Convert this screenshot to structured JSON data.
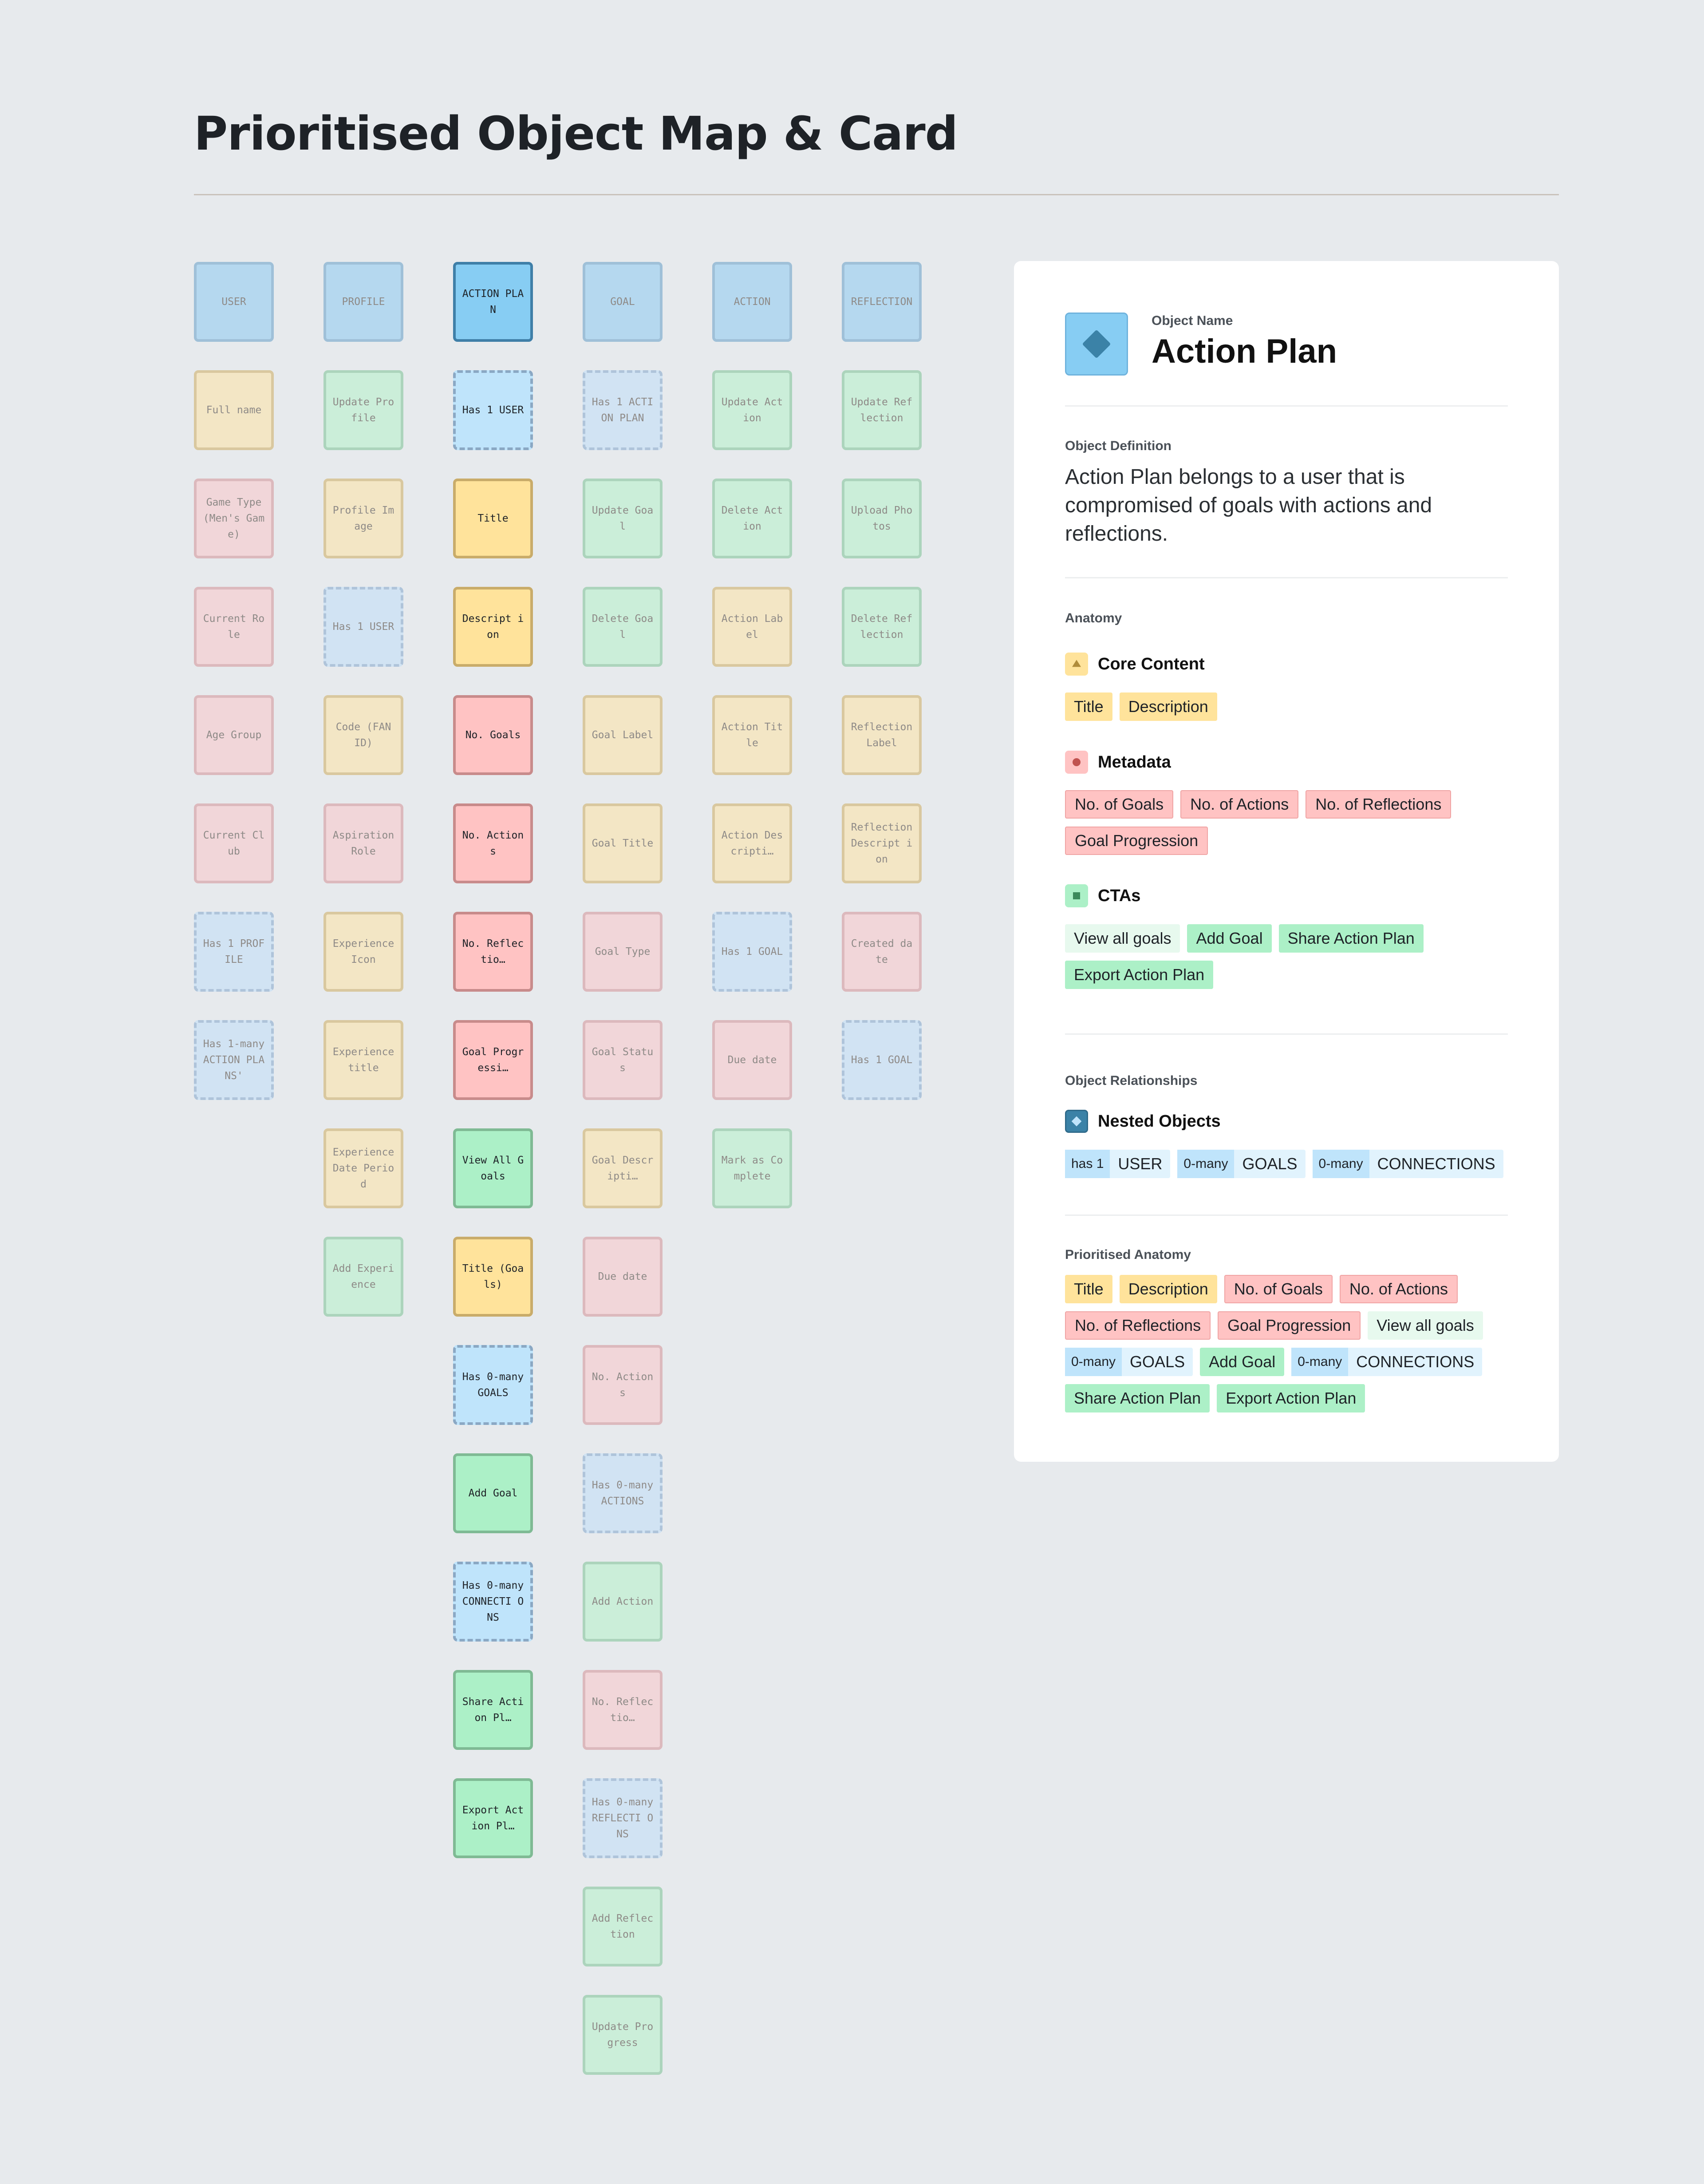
{
  "title": "Prioritised Object Map & Card",
  "map": {
    "columns": [
      {
        "header": "USER",
        "cells": [
          {
            "label": "Full name",
            "type": "core"
          },
          {
            "label": "Game Type (Men's Game)",
            "type": "meta"
          },
          {
            "label": "Current Role",
            "type": "meta"
          },
          {
            "label": "Age Group",
            "type": "meta"
          },
          {
            "label": "Current Club",
            "type": "meta"
          },
          {
            "label": "Has 1 PROFILE",
            "type": "nest"
          },
          {
            "label": "Has 1-many ACTION PLANS'",
            "type": "nest"
          }
        ]
      },
      {
        "header": "PROFILE",
        "cells": [
          {
            "label": "Update Profile",
            "type": "cta"
          },
          {
            "label": "Profile Image",
            "type": "core"
          },
          {
            "label": "Has 1 USER",
            "type": "nest"
          },
          {
            "label": "Code (FAN ID)",
            "type": "core"
          },
          {
            "label": "Aspiration Role",
            "type": "meta"
          },
          {
            "label": "Experience Icon",
            "type": "core"
          },
          {
            "label": "Experience title",
            "type": "core"
          },
          {
            "label": "Experience Date Period",
            "type": "core"
          },
          {
            "label": "Add Experience",
            "type": "cta"
          }
        ]
      },
      {
        "header": "ACTION PLAN",
        "active": true,
        "cells": [
          {
            "label": "Has 1 USER",
            "type": "nest"
          },
          {
            "label": "Title",
            "type": "core"
          },
          {
            "label": "Descript ion",
            "type": "core"
          },
          {
            "label": "No. Goals",
            "type": "meta"
          },
          {
            "label": "No. Actions",
            "type": "meta"
          },
          {
            "label": "No. Reflectio…",
            "type": "meta"
          },
          {
            "label": "Goal Progressi…",
            "type": "meta"
          },
          {
            "label": "View All Goals",
            "type": "cta"
          },
          {
            "label": "Title (Goals)",
            "type": "core"
          },
          {
            "label": "Has 0-many GOALS",
            "type": "nest"
          },
          {
            "label": "Add Goal",
            "type": "cta"
          },
          {
            "label": "Has 0-many CONNECTI ONS",
            "type": "nest"
          },
          {
            "label": "Share Action Pl…",
            "type": "cta"
          },
          {
            "label": "Export Action Pl…",
            "type": "cta"
          }
        ]
      },
      {
        "header": "GOAL",
        "cells": [
          {
            "label": "Has 1 ACTION PLAN",
            "type": "nest"
          },
          {
            "label": "Update Goal",
            "type": "cta"
          },
          {
            "label": "Delete Goal",
            "type": "cta"
          },
          {
            "label": "Goal Label",
            "type": "core"
          },
          {
            "label": "Goal Title",
            "type": "core"
          },
          {
            "label": "Goal Type",
            "type": "meta"
          },
          {
            "label": "Goal Status",
            "type": "meta"
          },
          {
            "label": "Goal Descripti…",
            "type": "core"
          },
          {
            "label": "Due date",
            "type": "meta"
          },
          {
            "label": "No. Actions",
            "type": "meta"
          },
          {
            "label": "Has 0-many ACTIONS",
            "type": "nest"
          },
          {
            "label": "Add Action",
            "type": "cta"
          },
          {
            "label": "No. Reflectio…",
            "type": "meta"
          },
          {
            "label": "Has 0-many REFLECTI ONS",
            "type": "nest"
          },
          {
            "label": "Add Reflection",
            "type": "cta"
          },
          {
            "label": "Update Progress",
            "type": "cta"
          }
        ]
      },
      {
        "header": "ACTION",
        "cells": [
          {
            "label": "Update Action",
            "type": "cta"
          },
          {
            "label": "Delete Action",
            "type": "cta"
          },
          {
            "label": "Action Label",
            "type": "core"
          },
          {
            "label": "Action Title",
            "type": "core"
          },
          {
            "label": "Action Descripti…",
            "type": "core"
          },
          {
            "label": "Has 1 GOAL",
            "type": "nest"
          },
          {
            "label": "Due date",
            "type": "meta"
          },
          {
            "label": "Mark as Complete",
            "type": "cta"
          }
        ]
      },
      {
        "header": "REFLECTION",
        "cells": [
          {
            "label": "Update Reflection",
            "type": "cta"
          },
          {
            "label": "Upload Photos",
            "type": "cta"
          },
          {
            "label": "Delete Reflection",
            "type": "cta"
          },
          {
            "label": "Reflection Label",
            "type": "core"
          },
          {
            "label": "Reflection Descript ion",
            "type": "core"
          },
          {
            "label": "Created date",
            "type": "meta"
          },
          {
            "label": "Has 1 GOAL",
            "type": "nest"
          }
        ]
      }
    ]
  },
  "card": {
    "name_label": "Object Name",
    "name": "Action Plan",
    "definition_label": "Object Definition",
    "definition": "Action Plan belongs to a user that is compromised of goals with actions and reflections.",
    "anatomy_label": "Anatomy",
    "core_title": "Core Content",
    "core_tags": [
      "Title",
      "Description"
    ],
    "meta_title": "Metadata",
    "meta_tags": [
      "No. of Goals",
      "No. of Actions",
      "No. of Reflections",
      "Goal Progression"
    ],
    "cta_title": "CTAs",
    "cta_tags": [
      {
        "label": "View all goals",
        "style": "cta-light"
      },
      {
        "label": "Add Goal",
        "style": "cta"
      },
      {
        "label": "Share Action Plan",
        "style": "cta"
      },
      {
        "label": "Export Action Plan",
        "style": "cta"
      }
    ],
    "relationships_label": "Object Relationships",
    "nested_title": "Nested Objects",
    "nested": [
      {
        "prefix": "has 1",
        "object": "USER"
      },
      {
        "prefix": "0-many",
        "object": "GOALS"
      },
      {
        "prefix": "0-many",
        "object": "CONNECTIONS"
      }
    ],
    "prioritised_label": "Prioritised Anatomy",
    "prioritised": [
      {
        "label": "Title",
        "style": "core"
      },
      {
        "label": "Description",
        "style": "core"
      },
      {
        "label": "No. of Goals",
        "style": "meta"
      },
      {
        "label": "No. of Actions",
        "style": "meta"
      },
      {
        "label": "No. of Reflections",
        "style": "meta"
      },
      {
        "label": "Goal Progression",
        "style": "meta"
      },
      {
        "label": "View all goals",
        "style": "cta-light"
      },
      {
        "prefix": "0-many",
        "label": "GOALS",
        "style": "nest"
      },
      {
        "label": "Add Goal",
        "style": "cta"
      },
      {
        "prefix": "0-many",
        "label": "CONNECTIONS",
        "style": "nest"
      },
      {
        "label": "Share Action Plan",
        "style": "cta"
      },
      {
        "label": "Export Action Plan",
        "style": "cta"
      }
    ]
  },
  "colors": {
    "core": "#ffe39b",
    "metadata": "#ffc3c3",
    "cta": "#acf0c7",
    "nested": "#bfe4fb",
    "object": "#87cdf3"
  }
}
